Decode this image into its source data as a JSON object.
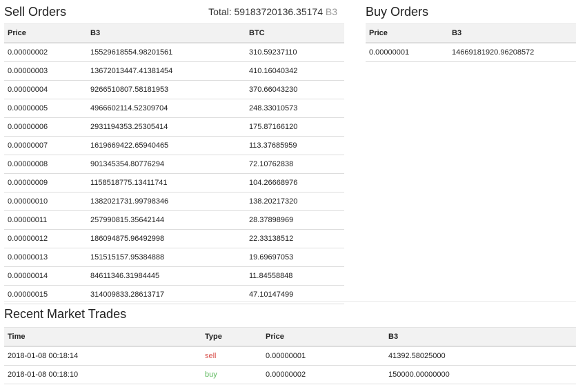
{
  "sell": {
    "title": "Sell Orders",
    "total_label": "Total: 59183720136.35174",
    "total_unit": "B3",
    "headers": [
      "Price",
      "B3",
      "BTC"
    ],
    "rows": [
      [
        "0.00000002",
        "15529618554.98201561",
        "310.59237110"
      ],
      [
        "0.00000003",
        "13672013447.41381454",
        "410.16040342"
      ],
      [
        "0.00000004",
        "9266510807.58181953",
        "370.66043230"
      ],
      [
        "0.00000005",
        "4966602114.52309704",
        "248.33010573"
      ],
      [
        "0.00000006",
        "2931194353.25305414",
        "175.87166120"
      ],
      [
        "0.00000007",
        "1619669422.65940465",
        "113.37685959"
      ],
      [
        "0.00000008",
        "901345354.80776294",
        "72.10762838"
      ],
      [
        "0.00000009",
        "1158518775.13411741",
        "104.26668976"
      ],
      [
        "0.00000010",
        "1382021731.99798346",
        "138.20217320"
      ],
      [
        "0.00000011",
        "257990815.35642144",
        "28.37898969"
      ],
      [
        "0.00000012",
        "186094875.96492998",
        "22.33138512"
      ],
      [
        "0.00000013",
        "151515157.95384888",
        "19.69697053"
      ],
      [
        "0.00000014",
        "84611346.31984445",
        "11.84558848"
      ],
      [
        "0.00000015",
        "314009833.28613717",
        "47.10147499"
      ]
    ]
  },
  "buy": {
    "title": "Buy Orders",
    "headers": [
      "Price",
      "B3"
    ],
    "rows": [
      [
        "0.00000001",
        "14669181920.96208572"
      ]
    ]
  },
  "trades": {
    "title": "Recent Market Trades",
    "headers": [
      "Time",
      "Type",
      "Price",
      "B3"
    ],
    "rows": [
      [
        "2018-01-08 00:18:14",
        "sell",
        "0.00000001",
        "41392.58025000"
      ],
      [
        "2018-01-08 00:18:10",
        "buy",
        "0.00000002",
        "150000.00000000"
      ]
    ]
  }
}
